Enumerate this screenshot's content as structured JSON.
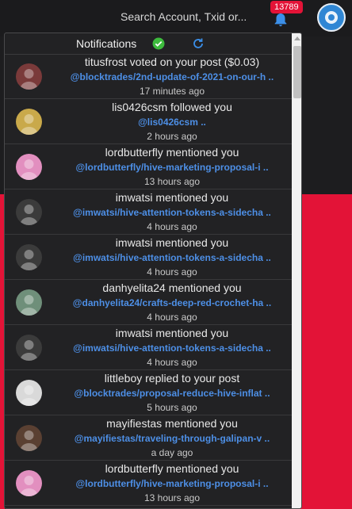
{
  "header": {
    "search_placeholder": "Search Account, Txid or...",
    "notification_count": "13789"
  },
  "panel": {
    "title": "Notifications"
  },
  "notifications": [
    {
      "text": "titusfrost voted on your post ($0.03)",
      "link": "@blocktrades/2nd-update-of-2021-on-our-h ..",
      "time": "17 minutes ago",
      "avatar": "#7a3a3a"
    },
    {
      "text": "lis0426csm followed you",
      "link": "@lis0426csm ..",
      "time": "2 hours ago",
      "avatar": "#c9a94a"
    },
    {
      "text": "lordbutterfly mentioned you",
      "link": "@lordbutterfly/hive-marketing-proposal-i ..",
      "time": "13 hours ago",
      "avatar": "#e28fbf"
    },
    {
      "text": "imwatsi mentioned you",
      "link": "@imwatsi/hive-attention-tokens-a-sidecha ..",
      "time": "4 hours ago",
      "avatar": "#3b3b3b"
    },
    {
      "text": "imwatsi mentioned you",
      "link": "@imwatsi/hive-attention-tokens-a-sidecha ..",
      "time": "4 hours ago",
      "avatar": "#3b3b3b"
    },
    {
      "text": "danhyelita24 mentioned you",
      "link": "@danhyelita24/crafts-deep-red-crochet-ha ..",
      "time": "4 hours ago",
      "avatar": "#6f8f7a"
    },
    {
      "text": "imwatsi mentioned you",
      "link": "@imwatsi/hive-attention-tokens-a-sidecha ..",
      "time": "4 hours ago",
      "avatar": "#3b3b3b"
    },
    {
      "text": "littleboy replied to your post",
      "link": "@blocktrades/proposal-reduce-hive-inflat ..",
      "time": "5 hours ago",
      "avatar": "#d9d9d9"
    },
    {
      "text": "mayifiestas mentioned you",
      "link": "@mayifiestas/traveling-through-galipan-v ..",
      "time": "a day ago",
      "avatar": "#5a4032"
    },
    {
      "text": "lordbutterfly mentioned you",
      "link": "@lordbutterfly/hive-marketing-proposal-i ..",
      "time": "13 hours ago",
      "avatar": "#e28fbf"
    }
  ]
}
